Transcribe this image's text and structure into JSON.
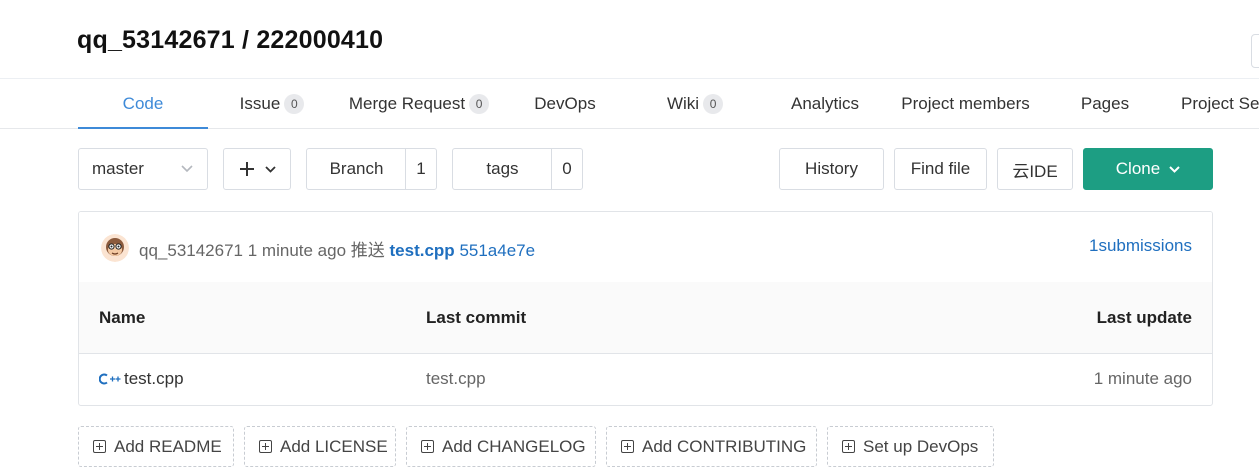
{
  "repo": {
    "title": "qq_53142671 / 222000410"
  },
  "tabs": [
    {
      "label": "Code",
      "count": null
    },
    {
      "label": "Issue",
      "count": "0"
    },
    {
      "label": "Merge Request",
      "count": "0"
    },
    {
      "label": "DevOps",
      "count": null
    },
    {
      "label": "Wiki",
      "count": "0"
    },
    {
      "label": "Analytics",
      "count": null
    },
    {
      "label": "Project members",
      "count": null
    },
    {
      "label": "Pages",
      "count": null
    },
    {
      "label": "Project Se",
      "count": null
    }
  ],
  "toolbar": {
    "branch_select": "master",
    "branch_label": "Branch",
    "branch_count": "1",
    "tags_label": "tags",
    "tags_count": "0",
    "history_label": "History",
    "find_file_label": "Find file",
    "ide_label": "云IDE",
    "clone_label": "Clone"
  },
  "commit": {
    "author": "qq_53142671",
    "time": "1 minute ago",
    "action": "推送",
    "file": "test.cpp",
    "hash": "551a4e7e",
    "submissions": "1submissions"
  },
  "table": {
    "headers": {
      "name": "Name",
      "last_commit": "Last commit",
      "last_update": "Last update"
    },
    "rows": [
      {
        "icon": "c++-file-icon",
        "name": "test.cpp",
        "last_commit": "test.cpp",
        "last_update": "1 minute ago"
      }
    ]
  },
  "actions": [
    {
      "label": "Add README"
    },
    {
      "label": "Add LICENSE"
    },
    {
      "label": "Add CHANGELOG"
    },
    {
      "label": "Add CONTRIBUTING"
    },
    {
      "label": "Set up DevOps"
    }
  ],
  "colors": {
    "accent": "#3e8ad8",
    "clone": "#1d9e83",
    "link": "#1f6fbf"
  }
}
